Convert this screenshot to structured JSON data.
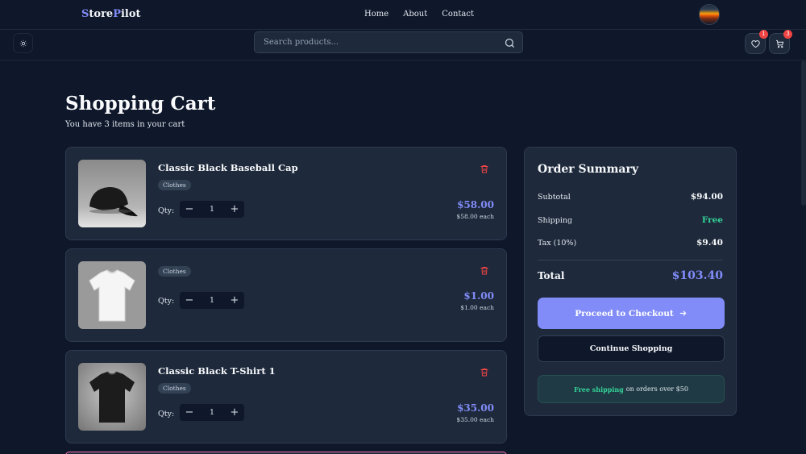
{
  "brand": {
    "first": "S",
    "mid": "tore",
    "accent": "P",
    "rest": "ilot"
  },
  "nav": {
    "links": [
      "Home",
      "About",
      "Contact"
    ]
  },
  "search": {
    "placeholder": "Search products..."
  },
  "header_icons": {
    "wishlist_count": "1",
    "cart_count": "3"
  },
  "page": {
    "title": "Shopping Cart",
    "subtitle": "You have 3 items in your cart"
  },
  "cart": {
    "qty_label": "Qty:",
    "items": [
      {
        "name": "Classic Black Baseball Cap",
        "category": "Clothes",
        "qty": "1",
        "price": "$58.00",
        "each": "$58.00 each",
        "image": "black-cap"
      },
      {
        "name": "",
        "category": "Clothes",
        "qty": "1",
        "price": "$1.00",
        "each": "$1.00 each",
        "image": "white-tshirt"
      },
      {
        "name": "Classic Black T-Shirt 1",
        "category": "Clothes",
        "qty": "1",
        "price": "$35.00",
        "each": "$35.00 each",
        "image": "black-tshirt"
      }
    ],
    "stepper": {
      "minus": "−",
      "plus": "+"
    }
  },
  "summary": {
    "title": "Order Summary",
    "subtotal_label": "Subtotal",
    "subtotal": "$94.00",
    "shipping_label": "Shipping",
    "shipping": "Free",
    "tax_label": "Tax (10%)",
    "tax": "$9.40",
    "total_label": "Total",
    "total": "$103.40",
    "checkout_label": "Proceed to Checkout",
    "continue_label": "Continue Shopping",
    "shipping_note_highlight": "Free shipping",
    "shipping_note_rest": "on orders over $50"
  },
  "colors": {
    "accent": "#818cf8",
    "free": "#34d399",
    "danger": "#ef4444",
    "background": "#0f172a",
    "card": "#1e293b"
  }
}
